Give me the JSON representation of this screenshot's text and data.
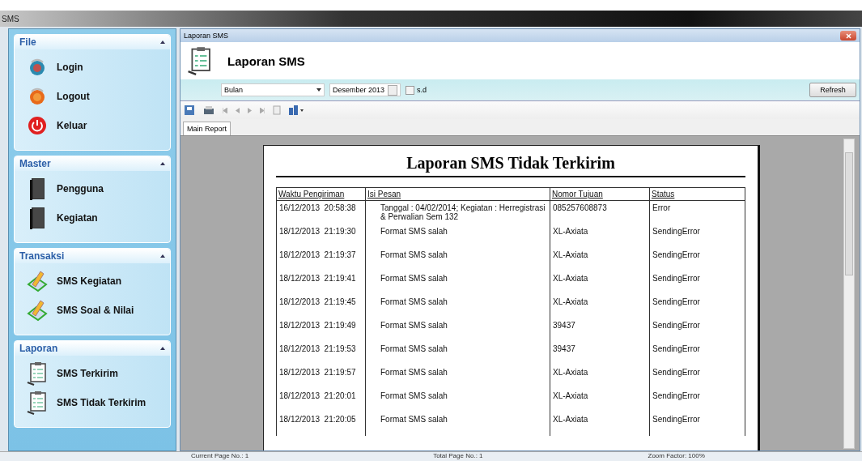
{
  "window": {
    "title": "SMS"
  },
  "sidebar": {
    "groups": [
      {
        "title": "File",
        "items": [
          {
            "label": "Login",
            "kind": "login"
          },
          {
            "label": "Logout",
            "kind": "logout"
          },
          {
            "label": "Keluar",
            "kind": "exit"
          }
        ]
      },
      {
        "title": "Master",
        "items": [
          {
            "label": "Pengguna",
            "kind": "book"
          },
          {
            "label": "Kegiatan",
            "kind": "book"
          }
        ]
      },
      {
        "title": "Transaksi",
        "items": [
          {
            "label": "SMS Kegiatan",
            "kind": "pencil"
          },
          {
            "label": "SMS Soal & Nilai",
            "kind": "pencil"
          }
        ]
      },
      {
        "title": "Laporan",
        "items": [
          {
            "label": "SMS Terkirim",
            "kind": "clipboard"
          },
          {
            "label": "SMS Tidak Terkirim",
            "kind": "clipboard"
          }
        ]
      }
    ]
  },
  "child_window": {
    "title": "Laporan SMS",
    "heading": "Laporan SMS"
  },
  "filter": {
    "period": "Bulan",
    "month": "Desember 2013",
    "range_checkbox": {
      "label": "s.d",
      "checked": false
    },
    "refresh_button": "Refresh"
  },
  "viewer_tab": "Main Report",
  "report": {
    "title": "Laporan SMS Tidak Terkirim",
    "columns": [
      "Waktu Pengiriman",
      "Isi Pesan",
      "Nomor Tujuan",
      "Status"
    ],
    "rows": [
      [
        "16/12/2013  20:58:38",
        "Tanggal : 04/02/2014; Kegiatan : Herregistrasi & Perwalian Sem 132",
        "085257608873",
        "Error"
      ],
      [
        "18/12/2013  21:19:30",
        "Format SMS salah",
        "XL-Axiata",
        "SendingError"
      ],
      [
        "18/12/2013  21:19:37",
        "Format SMS salah",
        "XL-Axiata",
        "SendingError"
      ],
      [
        "18/12/2013  21:19:41",
        "Format SMS salah",
        "XL-Axiata",
        "SendingError"
      ],
      [
        "18/12/2013  21:19:45",
        "Format SMS salah",
        "XL-Axiata",
        "SendingError"
      ],
      [
        "18/12/2013  21:19:49",
        "Format SMS salah",
        "39437",
        "SendingError"
      ],
      [
        "18/12/2013  21:19:53",
        "Format SMS salah",
        "39437",
        "SendingError"
      ],
      [
        "18/12/2013  21:19:57",
        "Format SMS salah",
        "XL-Axiata",
        "SendingError"
      ],
      [
        "18/12/2013  21:20:01",
        "Format SMS salah",
        "XL-Axiata",
        "SendingError"
      ],
      [
        "18/12/2013  21:20:05",
        "Format SMS salah",
        "XL-Axiata",
        "SendingError"
      ]
    ]
  },
  "status_bar": [
    "Current Page No.: 1",
    "Total Page No.: 1",
    "Zoom Factor: 100%"
  ]
}
